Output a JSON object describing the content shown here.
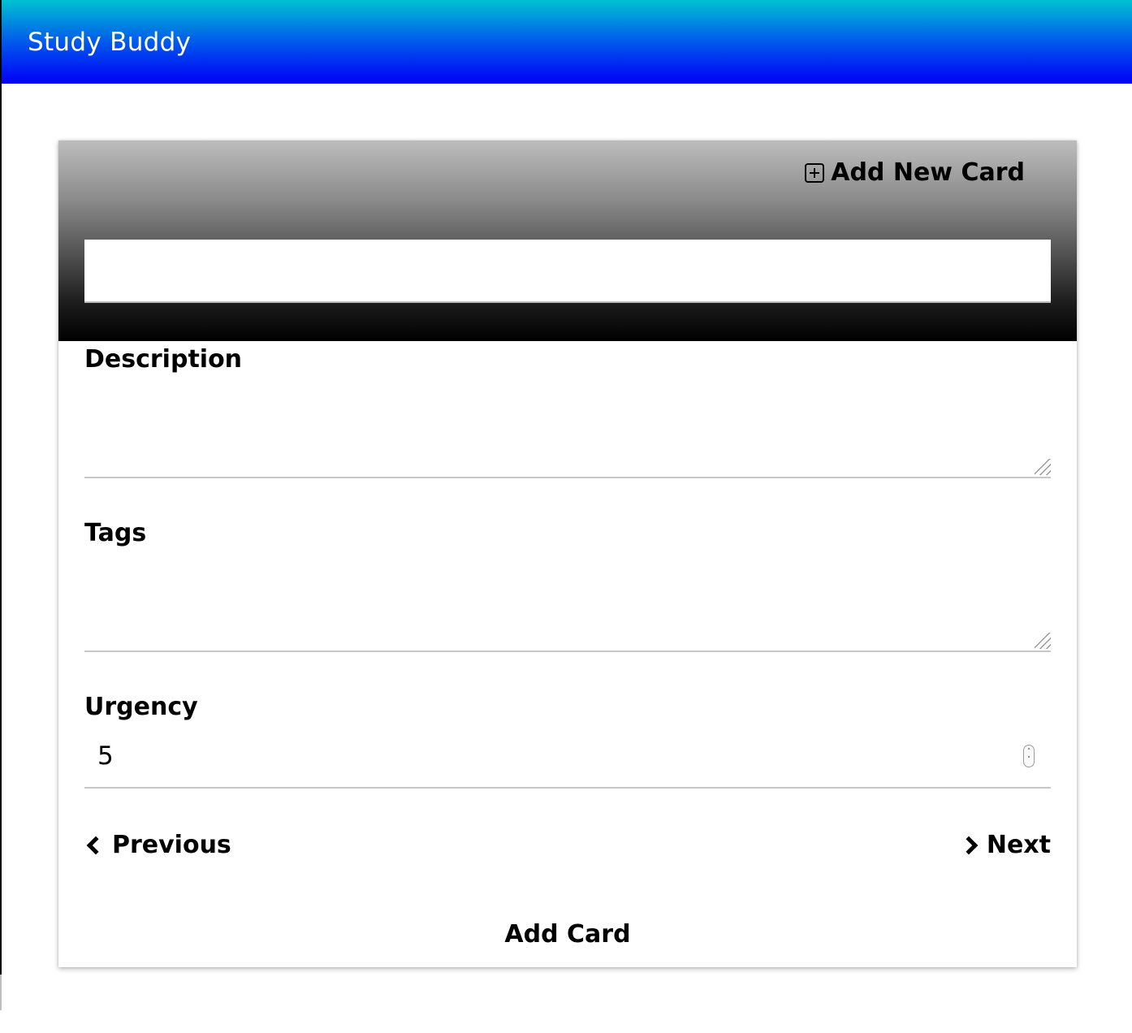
{
  "app": {
    "title": "Study Buddy"
  },
  "card": {
    "header_action": "Add New Card",
    "title_input": {
      "value": "",
      "placeholder": ""
    },
    "description": {
      "label": "Description",
      "value": ""
    },
    "tags": {
      "label": "Tags",
      "value": ""
    },
    "urgency": {
      "label": "Urgency",
      "value": "5"
    },
    "nav": {
      "previous": "Previous",
      "next": "Next"
    },
    "submit": "Add Card"
  },
  "icons": {
    "add": "plus-square-icon",
    "previous": "chevron-left-icon",
    "next": "chevron-right-icon"
  },
  "colors": {
    "header_gradient_top": "#00c2d0",
    "header_gradient_bottom": "#0000f5",
    "card_head_top": "#bdbdbd",
    "card_head_bottom": "#000000"
  }
}
